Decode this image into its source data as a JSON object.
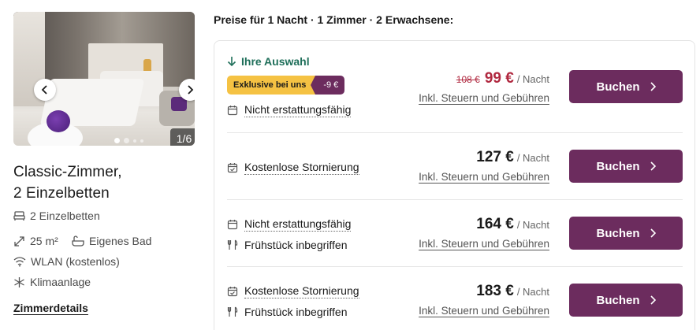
{
  "colors": {
    "brand": "#6c2c5e",
    "deal": "#b0283f",
    "selection": "#1f6f5a",
    "promo": "#f5c243"
  },
  "room": {
    "image_counter": "1/6",
    "title_line1": "Classic-Zimmer,",
    "title_line2": "2 Einzelbetten",
    "features": {
      "beds": "2 Einzelbetten",
      "size": "25 m²",
      "bath": "Eigenes Bad",
      "wifi": "WLAN (kostenlos)",
      "ac": "Klimaanlage"
    },
    "details_link": "Zimmerdetails"
  },
  "prices_heading": "Preise für 1 Nacht · 1 Zimmer · 2 Erwachsene:",
  "offers": [
    {
      "selection_label": "Ihre Auswahl",
      "promo_label": "Exklusive bei uns",
      "promo_discount": "-9 €",
      "policy": "Nicht erstattungsfähig",
      "old_price": "108 €",
      "price": "99 €",
      "unit": "/ Nacht",
      "tax_note": "Inkl. Steuern und Gebühren",
      "book_label": "Buchen"
    },
    {
      "policy": "Kostenlose Stornierung",
      "price": "127 €",
      "unit": "/ Nacht",
      "tax_note": "Inkl. Steuern und Gebühren",
      "book_label": "Buchen"
    },
    {
      "policy": "Nicht erstattungsfähig",
      "meal": "Frühstück inbegriffen",
      "price": "164 €",
      "unit": "/ Nacht",
      "tax_note": "Inkl. Steuern und Gebühren",
      "book_label": "Buchen"
    },
    {
      "policy": "Kostenlose Stornierung",
      "meal": "Frühstück inbegriffen",
      "price": "183 €",
      "unit": "/ Nacht",
      "tax_note": "Inkl. Steuern und Gebühren",
      "book_label": "Buchen"
    }
  ]
}
